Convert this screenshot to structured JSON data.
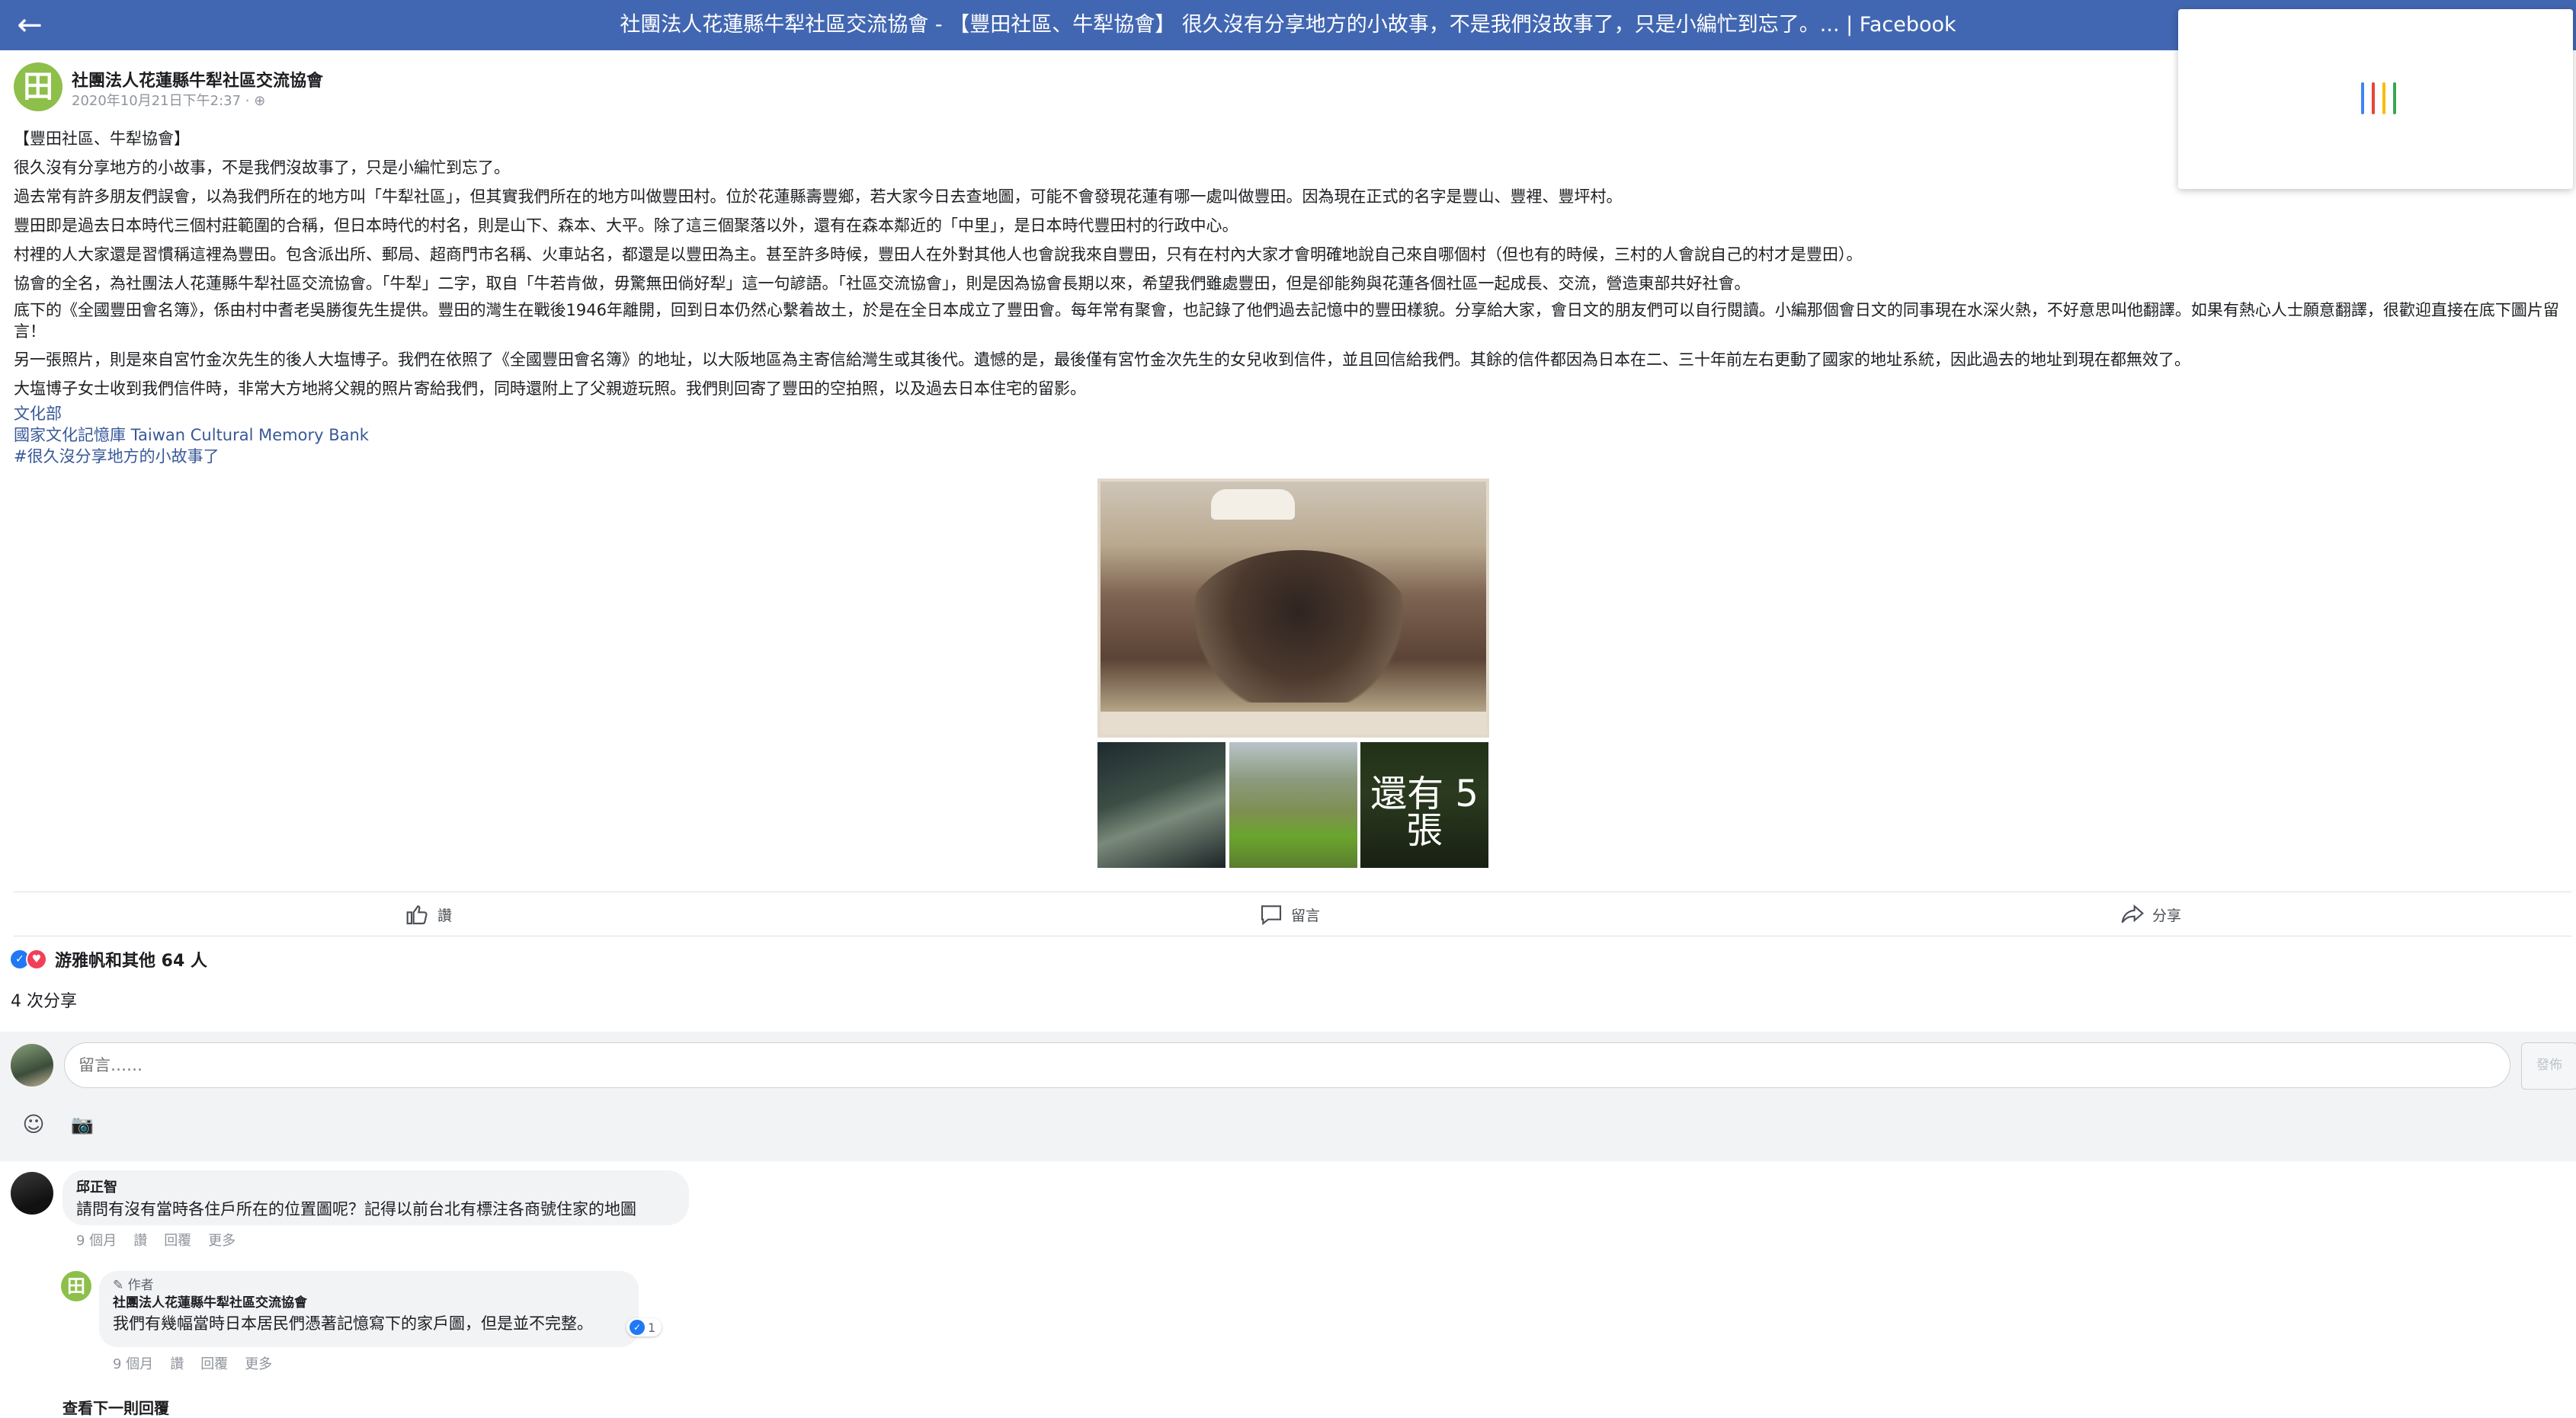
{
  "header": {
    "back_icon": "arrow-left-icon",
    "title": "社團法人花蓮縣牛犁社區交流協會 - 【豐田社區、牛犁協會】 很久沒有分享地方的小故事，不是我們沒故事了，只是小編忙到忘了。... | Facebook"
  },
  "post": {
    "page_name": "社團法人花蓮縣牛犁社區交流協會",
    "timestamp": "2020年10月21日下午2:37 · ",
    "paragraphs": [
      "【豐田社區、牛犁協會】",
      "很久沒有分享地方的小故事，不是我們沒故事了，只是小編忙到忘了。",
      "過去常有許多朋友們誤會，以為我們所在的地方叫「牛犁社區」，但其實我們所在的地方叫做豐田村。位於花蓮縣壽豐鄉，若大家今日去查地圖，可能不會發現花蓮有哪一處叫做豐田。因為現在正式的名字是豐山、豐裡、豐坪村。",
      "豐田即是過去日本時代三個村莊範圍的合稱，但日本時代的村名，則是山下、森本、大平。除了這三個聚落以外，還有在森本鄰近的「中里」，是日本時代豐田村的行政中心。",
      "村裡的人大家還是習慣稱這裡為豐田。包含派出所、郵局、超商門市名稱、火車站名，都還是以豐田為主。甚至許多時候，豐田人在外對其他人也會說我來自豐田，只有在村內大家才會明確地說自己來自哪個村（但也有的時候，三村的人會說自己的村才是豐田）。",
      "協會的全名，為社團法人花蓮縣牛犁社區交流協會。「牛犁」二字，取自「牛若肯做，毋驚無田倘好犁」這一句諺語。「社區交流協會」，則是因為協會長期以來，希望我們雖處豐田，但是卻能夠與花蓮各個社區一起成長、交流，營造東部共好社會。",
      "底下的《全國豐田會名簿》，係由村中耆老吳勝復先生提供。豐田的灣生在戰後1946年離開，回到日本仍然心繫着故土，於是在全日本成立了豐田會。每年常有聚會，也記錄了他們過去記憶中的豐田樣貌。分享給大家，會日文的朋友們可以自行閱讀。小編那個會日文的同事現在水深火熱，不好意思叫他翻譯。如果有熱心人士願意翻譯，很歡迎直接在底下圖片留言！",
      "另一張照片，則是來自宮竹金次先生的後人大塩博子。我們在依照了《全國豐田會名簿》的地址，以大阪地區為主寄信給灣生或其後代。遺憾的是，最後僅有宮竹金次先生的女兒收到信件，並且回信給我們。其餘的信件都因為日本在二、三十年前左右更動了國家的地址系統，因此過去的地址到現在都無效了。",
      "大塩博子女士收到我們信件時，非常大方地將父親的照片寄給我們，同時還附上了父親遊玩照。我們則回寄了豐田的空拍照，以及過去日本住宅的留影。"
    ],
    "links": [
      "文化部",
      "國家文化記憶庫 Taiwan Cultural Memory Bank",
      "#很久沒分享地方的小故事了"
    ],
    "more_photos_label": "還有 5 張"
  },
  "actions": {
    "like": "讚",
    "comment": "留言",
    "share": "分享"
  },
  "reactions": {
    "summary": "游雅帆和其他 64 人",
    "shares": "4 次分享"
  },
  "composer": {
    "placeholder": "留言……",
    "post_button": "發佈"
  },
  "comments": [
    {
      "author": "邱正智",
      "text": "請問有沒有當時各住戶所在的位置圖呢？記得以前台北有標注各商號住家的地圖",
      "meta": {
        "time": "9 個月",
        "like": "讚",
        "reply": "回覆",
        "more": "更多"
      }
    },
    {
      "author_tag": "作者",
      "author": "社團法人花蓮縣牛犁社區交流協會",
      "text": "我們有幾幅當時日本居民們憑著記憶寫下的家戶圖，但是並不完整。",
      "like_count": "1",
      "meta": {
        "time": "9 個月",
        "like": "讚",
        "reply": "回覆",
        "more": "更多"
      }
    }
  ],
  "more_replies": "查看下一則回覆",
  "loader_colors": [
    "#4285f4",
    "#ea4335",
    "#fbbc05",
    "#34a853"
  ]
}
